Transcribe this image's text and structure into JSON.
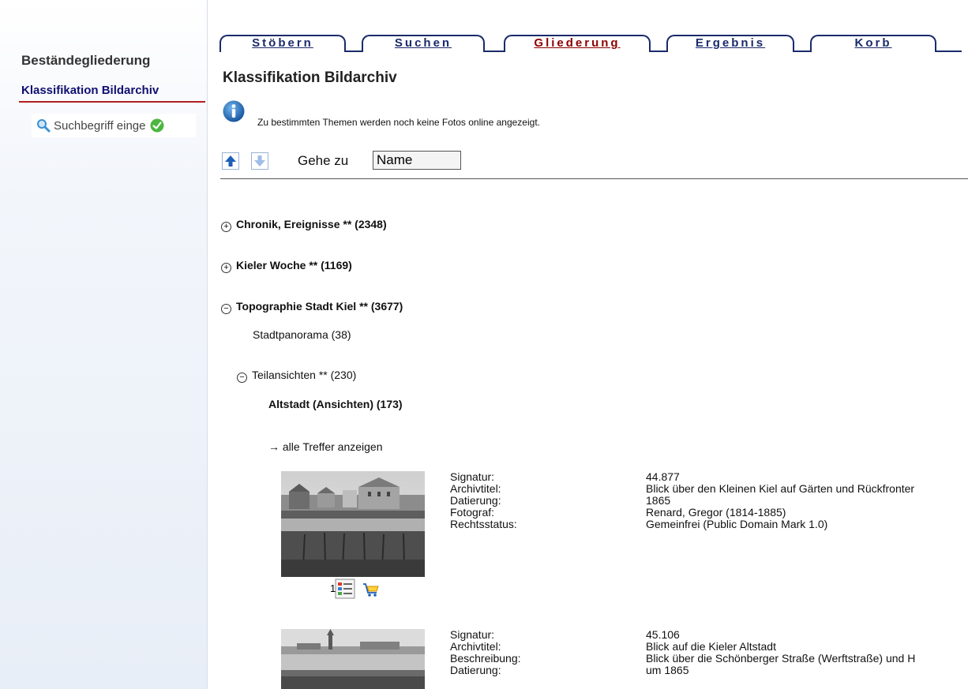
{
  "sidebar": {
    "title": "Beständegliederung",
    "subtitle": "Klassifikation Bildarchiv",
    "search_placeholder": "Suchbegriff einge"
  },
  "tabs": [
    {
      "label": "Stöbern",
      "active": false
    },
    {
      "label": "Suchen",
      "active": false
    },
    {
      "label": "Gliederung",
      "active": true
    },
    {
      "label": "Ergebnis",
      "active": false
    },
    {
      "label": "Korb",
      "active": false
    }
  ],
  "main": {
    "title": "Klassifikation Bildarchiv",
    "info_text": "Zu bestimmten Themen werden noch keine Fotos online angezeigt.",
    "goto_label": "Gehe zu",
    "goto_value": "Name"
  },
  "tree": {
    "chronik": {
      "symbol": "+",
      "label": "Chronik, Ereignisse ** (2348)"
    },
    "kieler_woche": {
      "symbol": "+",
      "label": "Kieler Woche ** (1169)"
    },
    "topographie": {
      "symbol": "−",
      "label": "Topographie Stadt Kiel ** (3677)"
    },
    "stadtpanorama": {
      "label": "Stadtpanorama (38)"
    },
    "teilansichten": {
      "symbol": "−",
      "label": "Teilansichten ** (230)"
    },
    "altstadt": {
      "label": "Altstadt (Ansichten) (173)"
    },
    "all_hits": "→ alle Treffer anzeigen"
  },
  "records": [
    {
      "number": "1.",
      "labels": [
        "Signatur:",
        "Archivtitel:",
        "Datierung:",
        "Fotograf:",
        "Rechtsstatus:"
      ],
      "values": [
        "44.877",
        "Blick über den Kleinen Kiel auf Gärten und Rückfronter",
        "1865",
        "Renard, Gregor (1814-1885)",
        "Gemeinfrei (Public Domain Mark 1.0)"
      ]
    },
    {
      "labels": [
        "Signatur:",
        "Archivtitel:",
        "Beschreibung:",
        "Datierung:"
      ],
      "values": [
        "45.106",
        "Blick auf die Kieler Altstadt",
        "Blick über die Schönberger Straße (Werftstraße) und H",
        "um 1865"
      ]
    }
  ],
  "colors": {
    "accent_navy": "#1a2a6c",
    "active_tab": "#8b0000",
    "sidebar_rule": "#b02020"
  }
}
